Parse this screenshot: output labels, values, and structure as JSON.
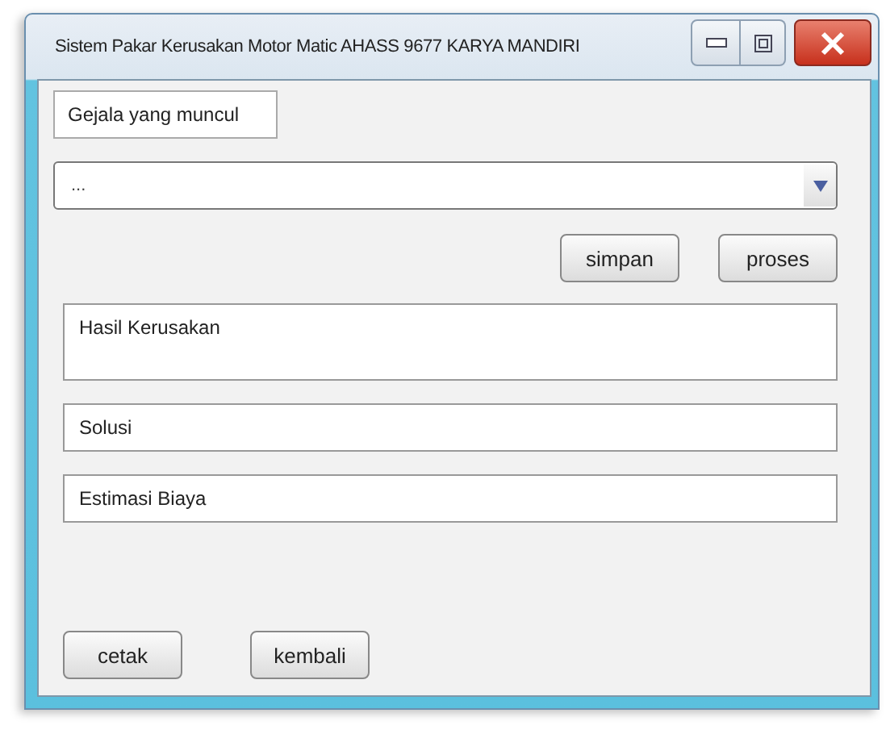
{
  "window": {
    "title": "Sistem Pakar Kerusakan Motor Matic AHASS 9677 KARYA MANDIRI"
  },
  "gejala_field": {
    "value": "Gejala yang muncul"
  },
  "combo": {
    "value": "..."
  },
  "action_buttons": [
    "simpan",
    "proses"
  ],
  "fields": [
    {
      "kind": "area",
      "value": "Hasil Kerusakan"
    },
    {
      "kind": "line",
      "value": "Solusi"
    },
    {
      "kind": "line",
      "value": "Estimasi Biaya"
    }
  ],
  "bottom_buttons": [
    "cetak",
    "kembali"
  ]
}
